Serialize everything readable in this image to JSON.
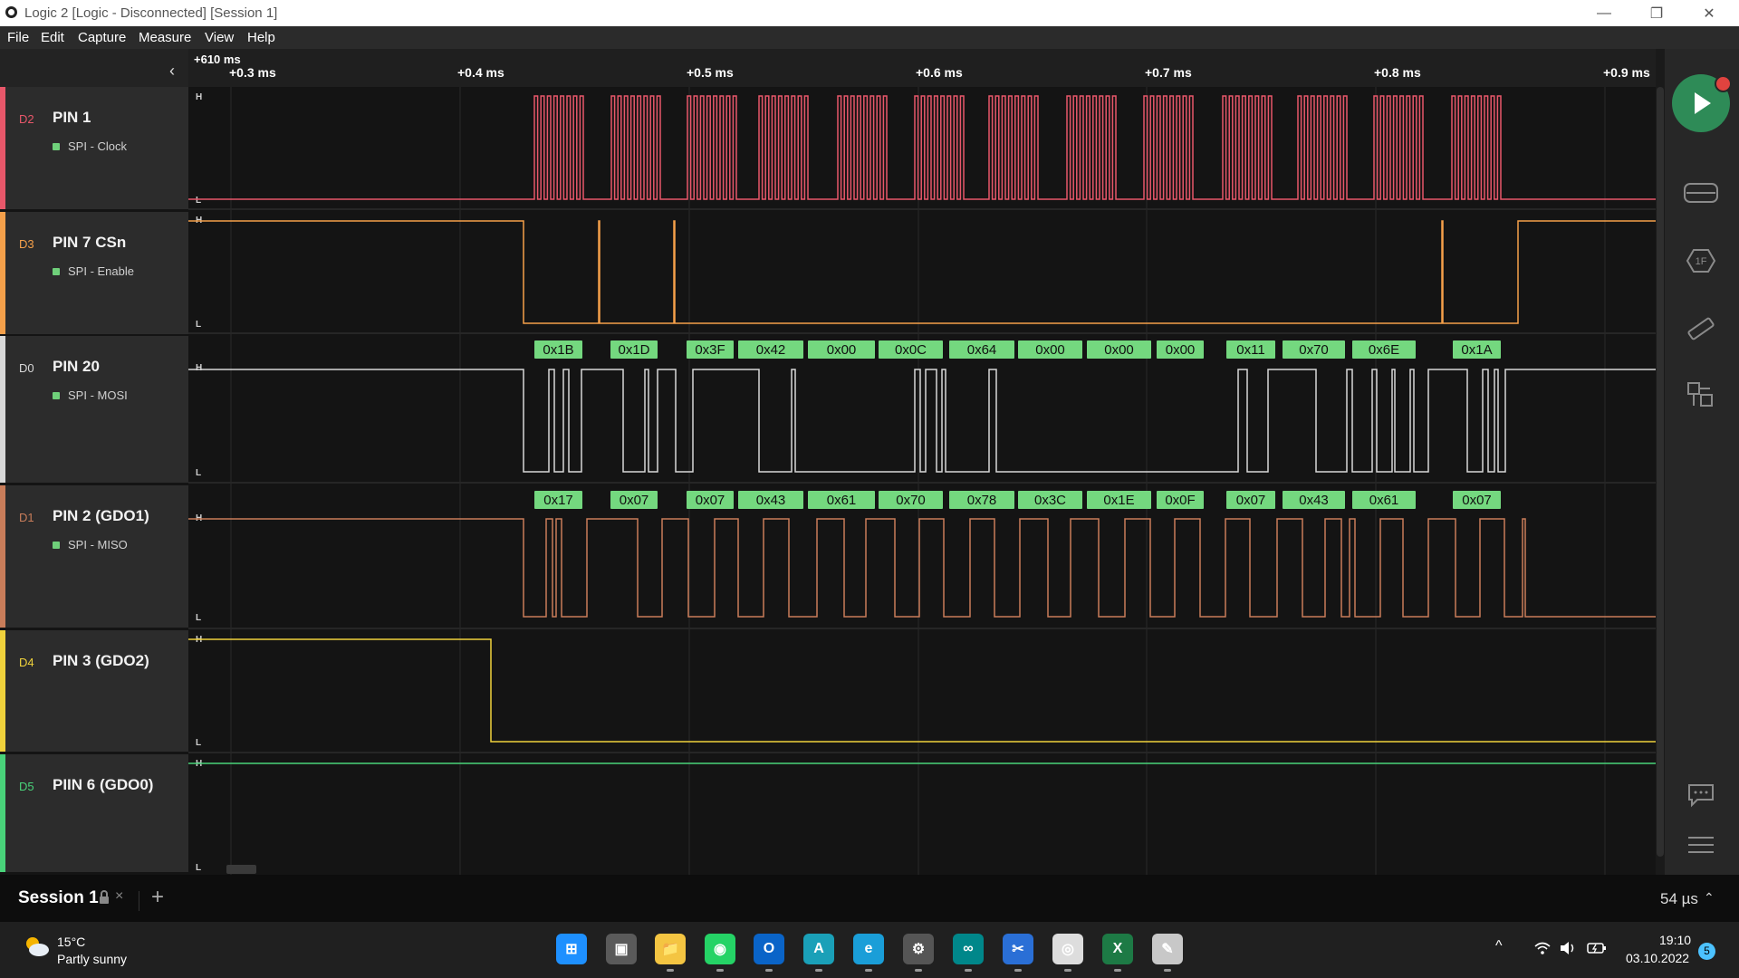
{
  "window": {
    "title": "Logic 2 [Logic - Disconnected] [Session 1]",
    "minimize": "—",
    "restore": "❐",
    "close": "✕"
  },
  "menu": [
    "File",
    "Edit",
    "Capture",
    "Measure",
    "View",
    "Help"
  ],
  "time_header": {
    "start": "+610 ms",
    "ticks": [
      "+0.3 ms",
      "+0.4 ms",
      "+0.5 ms",
      "+0.6 ms",
      "+0.7 ms",
      "+0.8 ms",
      "+0.9 ms"
    ]
  },
  "collapse_icon": "chevron-left-icon",
  "channels": [
    {
      "id": "D2",
      "name": "PIN 1",
      "analyzer": "SPI - Clock",
      "color": "#e8576a",
      "has_analyzer": true
    },
    {
      "id": "D3",
      "name": "PIN 7 CSn",
      "analyzer": "SPI - Enable",
      "color": "#f5a04a",
      "has_analyzer": true
    },
    {
      "id": "D0",
      "name": "PIN 20",
      "analyzer": "SPI - MOSI",
      "color": "#d8d8d8",
      "has_analyzer": true
    },
    {
      "id": "D1",
      "name": "PIN 2 (GDO1)",
      "analyzer": "SPI - MISO",
      "color": "#c97d5a",
      "has_analyzer": true
    },
    {
      "id": "D4",
      "name": "PIN 3 (GDO2)",
      "analyzer": "",
      "color": "#f0d23c",
      "has_analyzer": false
    },
    {
      "id": "D5",
      "name": "PIIN 6 (GDO0)",
      "analyzer": "",
      "color": "#49d37a",
      "has_analyzer": false
    }
  ],
  "level_labels": {
    "high": "H",
    "low": "L"
  },
  "mosi_bytes": [
    "0x1B",
    "0x1D",
    "0x3F",
    "0x42",
    "0x00",
    "0x0C",
    "0x64",
    "0x00",
    "0x00",
    "0x00",
    "0x11",
    "0x70",
    "0x6E",
    "0x1A"
  ],
  "miso_bytes": [
    "0x17",
    "0x07",
    "0x07",
    "0x43",
    "0x61",
    "0x70",
    "0x78",
    "0x3C",
    "0x1E",
    "0x0F",
    "0x07",
    "0x43",
    "0x61",
    "0x07"
  ],
  "right_toolbar": {
    "run_icon": "play-icon",
    "tools": [
      "analyzers-icon",
      "extensions-icon",
      "measure-icon",
      "timing-markers-icon"
    ],
    "bottom_tools": [
      "notes-icon",
      "menu-icon"
    ]
  },
  "session": {
    "tab": "Session 1",
    "lock_icon": "lock-icon",
    "close": "×",
    "add": "+",
    "timing": "54 µs",
    "timing_chevron": "chevron-up-icon"
  },
  "taskbar": {
    "weather_temp": "15°C",
    "weather_desc": "Partly sunny",
    "weather_icon": "partly-sunny-icon",
    "apps": [
      {
        "name": "windows-start-icon",
        "color": "#1e90ff",
        "glyph": "⊞"
      },
      {
        "name": "task-view-icon",
        "color": "#5a5a5a",
        "glyph": "▣"
      },
      {
        "name": "file-explorer-icon",
        "color": "#f4c542",
        "glyph": "📁"
      },
      {
        "name": "whatsapp-icon",
        "color": "#25d366",
        "glyph": "◉"
      },
      {
        "name": "outlook-icon",
        "color": "#0a64c8",
        "glyph": "O"
      },
      {
        "name": "font-app-icon",
        "color": "#1aa0b8",
        "glyph": "A"
      },
      {
        "name": "edge-icon",
        "color": "#1a9ed8",
        "glyph": "e"
      },
      {
        "name": "utility-app-icon",
        "color": "#555555",
        "glyph": "⚙"
      },
      {
        "name": "arduino-icon",
        "color": "#00878a",
        "glyph": "∞"
      },
      {
        "name": "snipping-tool-icon",
        "color": "#2a6fd6",
        "glyph": "✂"
      },
      {
        "name": "logic-app-icon",
        "color": "#dddddd",
        "glyph": "◎"
      },
      {
        "name": "excel-icon",
        "color": "#1d7a45",
        "glyph": "X"
      },
      {
        "name": "paint-icon",
        "color": "#c8c8c8",
        "glyph": "✎"
      }
    ],
    "tray_chevron": "^",
    "wifi_icon": "wifi-icon",
    "volume_icon": "volume-icon",
    "battery_icon": "battery-icon",
    "time": "19:10",
    "date": "03.10.2022",
    "notifications": "5"
  }
}
